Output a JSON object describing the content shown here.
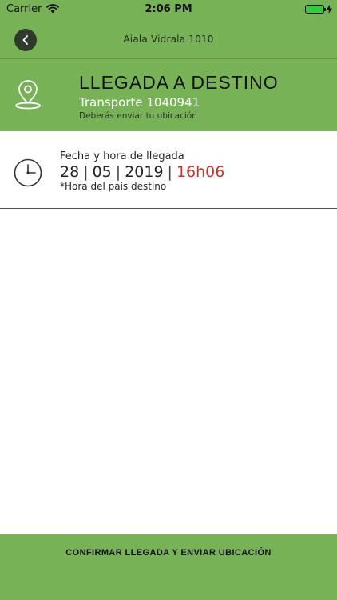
{
  "status_bar": {
    "carrier": "Carrier",
    "time": "2:06 PM"
  },
  "nav": {
    "title": "Aiala Vidrala 1010"
  },
  "header": {
    "title": "LLEGADA A DESTINO",
    "subtitle": "Transporte 1040941",
    "note": "Deberás enviar tu ubicación"
  },
  "arrival": {
    "label": "Fecha y hora de llegada",
    "day": "28",
    "month": "05",
    "year": "2019",
    "time": "16h06",
    "separator": "|",
    "note": "*Hora del país destino"
  },
  "footer": {
    "confirm_label": "CONFIRMAR LLEGADA Y ENVIAR UBICACIÓN"
  },
  "colors": {
    "primary_green": "#78b256",
    "time_red": "#c0392b",
    "back_button": "#2e3a2a"
  }
}
